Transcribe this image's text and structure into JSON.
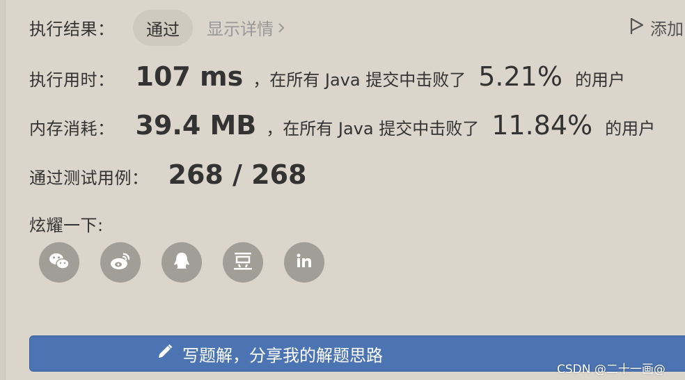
{
  "result": {
    "label": "执行结果：",
    "status": "通过",
    "details_link": "显示详情",
    "add_note": "添加"
  },
  "runtime": {
    "label": "执行用时：",
    "value": "107 ms",
    "text": "，在所有 Java 提交中击败了",
    "percent": "5.21%",
    "suffix": "的用户"
  },
  "memory": {
    "label": "内存消耗：",
    "value": "39.4 MB",
    "text": "，在所有 Java 提交中击败了",
    "percent": "11.84%",
    "suffix": "的用户"
  },
  "tests": {
    "label": "通过测试用例：",
    "value": "268 / 268"
  },
  "share": {
    "label": "炫耀一下:",
    "icons": [
      "wechat-icon",
      "weibo-icon",
      "qq-icon",
      "douban-icon",
      "linkedin-icon"
    ]
  },
  "write_button": {
    "label": "写题解，分享我的解题思路"
  },
  "watermark": "CSDN @二十一画@",
  "colors": {
    "background": "#dbd5cb",
    "badge": "#cfcabd",
    "icon_circle": "#a19e98",
    "button": "#4c74b2"
  }
}
